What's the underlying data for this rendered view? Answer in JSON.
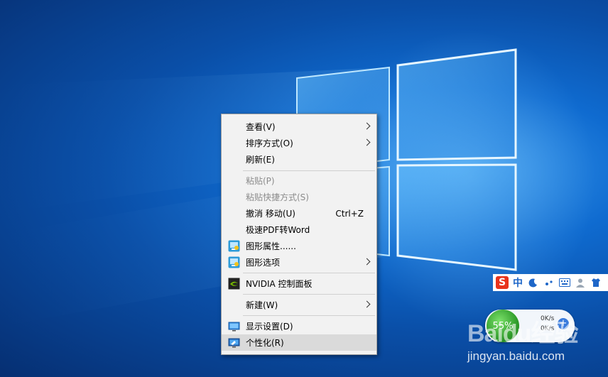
{
  "context_menu": {
    "items": [
      {
        "label": "查看(V)",
        "has_submenu": true
      },
      {
        "label": "排序方式(O)",
        "has_submenu": true
      },
      {
        "label": "刷新(E)"
      },
      {
        "label": "粘贴(P)",
        "disabled": true
      },
      {
        "label": "粘贴快捷方式(S)",
        "disabled": true
      },
      {
        "label": "撤消 移动(U)",
        "shortcut": "Ctrl+Z"
      },
      {
        "label": "极速PDF转Word"
      },
      {
        "label": "图形属性......"
      },
      {
        "label": "图形选项",
        "has_submenu": true
      },
      {
        "label": "NVIDIA 控制面板"
      },
      {
        "label": "新建(W)",
        "has_submenu": true
      },
      {
        "label": "显示设置(D)"
      },
      {
        "label": "个性化(R)",
        "highlighted": true
      }
    ]
  },
  "ime_bar": {
    "brand": "S",
    "mode": "中"
  },
  "net_widget": {
    "percent": "55%",
    "up_speed": "0K/s",
    "down_speed": "0K/s",
    "plus": "+"
  },
  "watermark": {
    "brand": "Baidu经验",
    "url": "jingyan.baidu.com"
  }
}
